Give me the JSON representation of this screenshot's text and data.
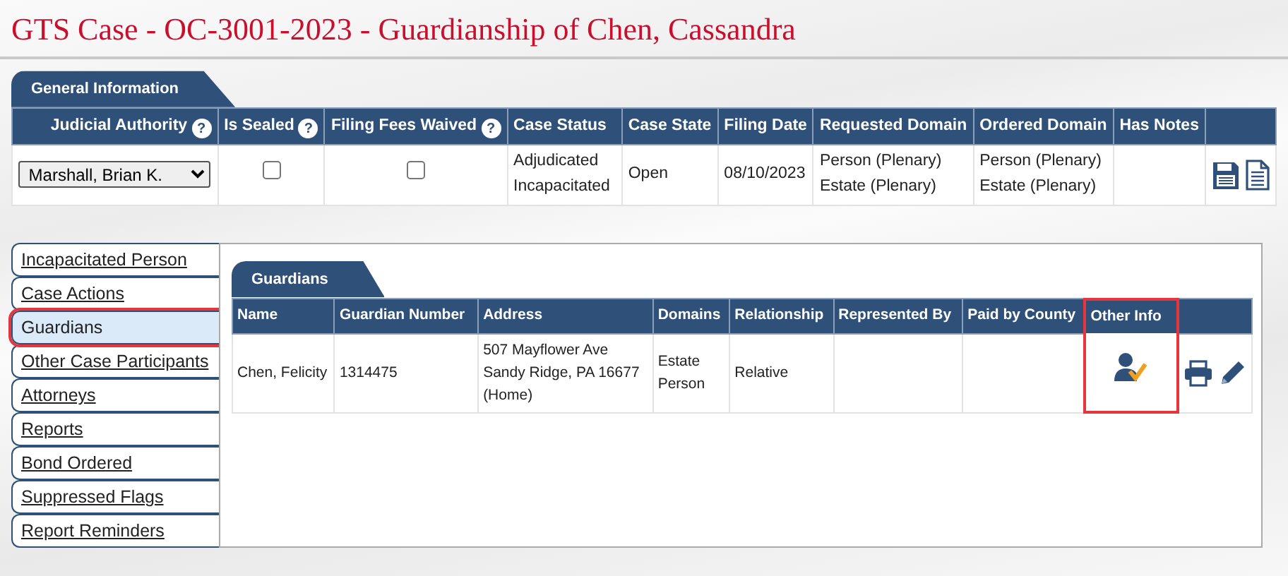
{
  "page_title": "GTS Case - OC-3001-2023 - Guardianship of Chen, Cassandra",
  "general_information": {
    "tab": "General Information",
    "columns": [
      {
        "label": "Judicial Authority",
        "help": "?"
      },
      {
        "label": "Is Sealed",
        "help": "?"
      },
      {
        "label": "Filing Fees Waived",
        "help": "?"
      },
      {
        "label": "Case Status"
      },
      {
        "label": "Case State"
      },
      {
        "label": "Filing Date"
      },
      {
        "label": "Requested Domain"
      },
      {
        "label": "Ordered Domain"
      },
      {
        "label": "Has Notes"
      }
    ],
    "judicial_authority": "Marshall, Brian K.",
    "is_sealed": {
      "checked": false
    },
    "filing_fees_waived": {
      "checked": false
    },
    "case_status": [
      "Adjudicated",
      "Incapacitated"
    ],
    "case_state": "Open",
    "filing_date": "08/10/2023",
    "requested_domain": [
      "Person (Plenary)",
      "Estate (Plenary)"
    ],
    "ordered_domain": [
      "Person (Plenary)",
      "Estate (Plenary)"
    ]
  },
  "sidebar": {
    "items": [
      {
        "label": "Incapacitated Person",
        "selected": false
      },
      {
        "label": "Case Actions",
        "selected": false
      },
      {
        "label": "Guardians",
        "selected": true
      },
      {
        "label": "Other Case Participants",
        "selected": false
      },
      {
        "label": "Attorneys",
        "selected": false
      },
      {
        "label": "Reports",
        "selected": false
      },
      {
        "label": "Bond Ordered",
        "selected": false
      },
      {
        "label": "Suppressed Flags",
        "selected": false
      },
      {
        "label": "Report Reminders",
        "selected": false
      }
    ]
  },
  "guardians": {
    "tab": "Guardians",
    "columns": [
      {
        "label": "Name",
        "highlighted": false
      },
      {
        "label": "Guardian Number",
        "highlighted": false
      },
      {
        "label": "Address",
        "highlighted": false
      },
      {
        "label": "Domains",
        "highlighted": false
      },
      {
        "label": "Relationship",
        "highlighted": false
      },
      {
        "label": "Represented By",
        "highlighted": false
      },
      {
        "label": "Paid by County",
        "highlighted": false
      },
      {
        "label": "Other Info",
        "highlighted": true
      }
    ],
    "rows": [
      {
        "name": "Chen, Felicity",
        "guardian_number": "1314475",
        "address": [
          "507 Mayflower Ave",
          "Sandy Ridge, PA 16677",
          "(Home)"
        ],
        "domains": [
          "Estate",
          "Person"
        ],
        "relationship": "Relative"
      }
    ]
  }
}
